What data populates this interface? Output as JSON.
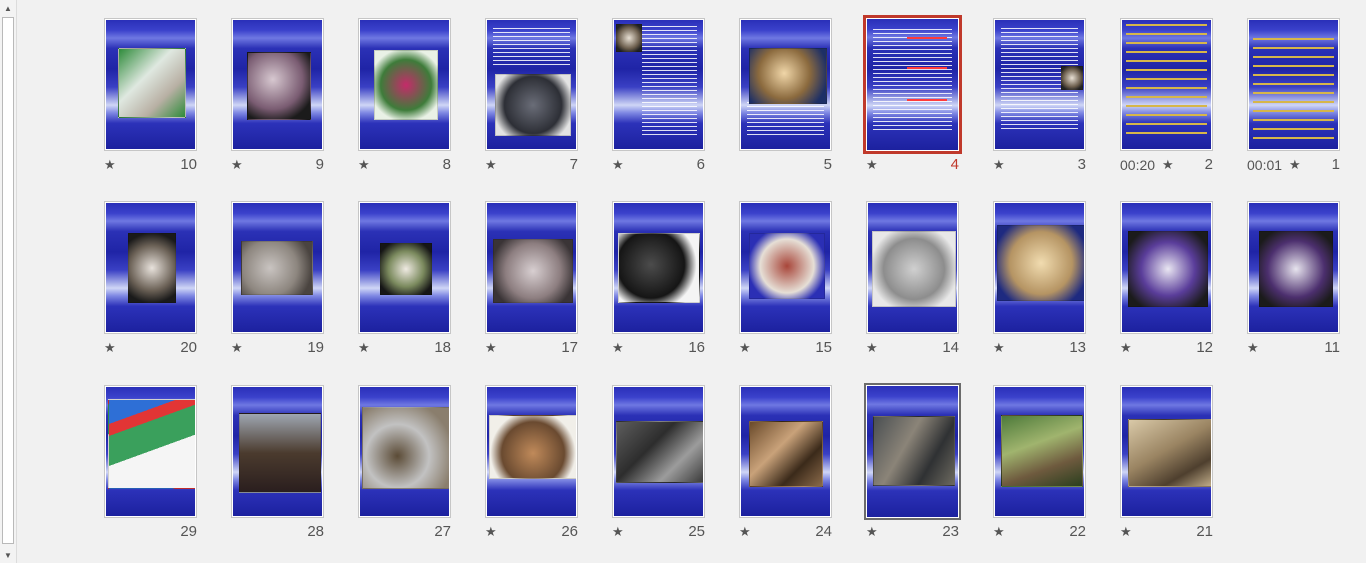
{
  "slides": [
    {
      "number": "10",
      "star": "★",
      "timing": ""
    },
    {
      "number": "9",
      "star": "★",
      "timing": ""
    },
    {
      "number": "8",
      "star": "★",
      "timing": ""
    },
    {
      "number": "7",
      "star": "★",
      "timing": ""
    },
    {
      "number": "6",
      "star": "★",
      "timing": ""
    },
    {
      "number": "5",
      "star": "",
      "timing": ""
    },
    {
      "number": "4",
      "star": "★",
      "timing": "",
      "selected": true
    },
    {
      "number": "3",
      "star": "★",
      "timing": ""
    },
    {
      "number": "2",
      "star": "★",
      "timing": "00:20"
    },
    {
      "number": "1",
      "star": "★",
      "timing": "00:01"
    },
    {
      "number": "20",
      "star": "★",
      "timing": ""
    },
    {
      "number": "19",
      "star": "★",
      "timing": ""
    },
    {
      "number": "18",
      "star": "★",
      "timing": ""
    },
    {
      "number": "17",
      "star": "★",
      "timing": ""
    },
    {
      "number": "16",
      "star": "★",
      "timing": ""
    },
    {
      "number": "15",
      "star": "★",
      "timing": ""
    },
    {
      "number": "14",
      "star": "★",
      "timing": ""
    },
    {
      "number": "13",
      "star": "★",
      "timing": ""
    },
    {
      "number": "12",
      "star": "★",
      "timing": ""
    },
    {
      "number": "11",
      "star": "★",
      "timing": ""
    },
    {
      "number": "29",
      "star": "",
      "timing": ""
    },
    {
      "number": "28",
      "star": "",
      "timing": ""
    },
    {
      "number": "27",
      "star": "",
      "timing": ""
    },
    {
      "number": "26",
      "star": "★",
      "timing": ""
    },
    {
      "number": "25",
      "star": "★",
      "timing": ""
    },
    {
      "number": "24",
      "star": "★",
      "timing": ""
    },
    {
      "number": "23",
      "star": "★",
      "timing": "",
      "hover": true
    },
    {
      "number": "22",
      "star": "★",
      "timing": ""
    },
    {
      "number": "21",
      "star": "★",
      "timing": ""
    }
  ],
  "icons": {
    "scroll_up": "scroll-up-arrow-icon",
    "scroll_down": "scroll-down-arrow-icon",
    "animation": "star-icon"
  },
  "colors": {
    "selected_border": "#c0392b",
    "slide_background": "#2a2fb8"
  }
}
